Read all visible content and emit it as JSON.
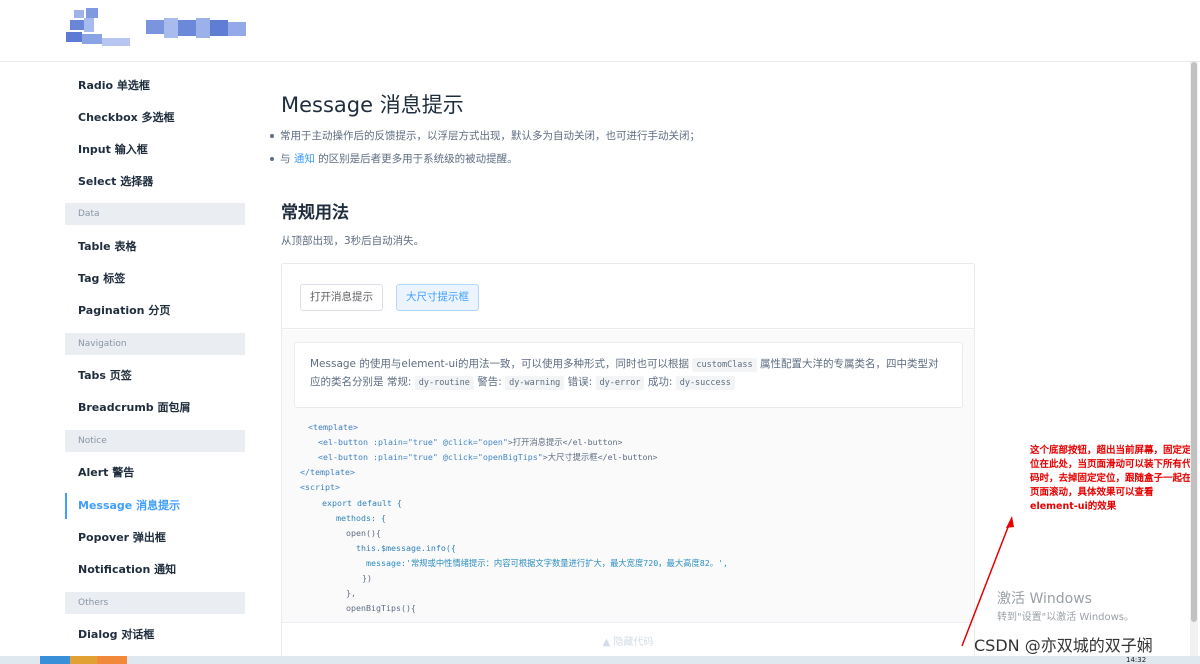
{
  "sidebar": {
    "items": [
      {
        "label": "Radio 单选框"
      },
      {
        "label": "Checkbox 多选框"
      },
      {
        "label": "Input 输入框"
      },
      {
        "label": "Select 选择器"
      },
      {
        "group": "Data"
      },
      {
        "label": "Table 表格"
      },
      {
        "label": "Tag 标签"
      },
      {
        "label": "Pagination 分页"
      },
      {
        "group": "Navigation"
      },
      {
        "label": "Tabs 页签"
      },
      {
        "label": "Breadcrumb 面包屑"
      },
      {
        "group": "Notice"
      },
      {
        "label": "Alert 警告"
      },
      {
        "label": "Message 消息提示",
        "active": true
      },
      {
        "label": "Popover 弹出框"
      },
      {
        "label": "Notification 通知"
      },
      {
        "group": "Others"
      },
      {
        "label": "Dialog 对话框"
      }
    ]
  },
  "page": {
    "title": "Message 消息提示",
    "bullet1": "常用于主动操作后的反馈提示，以浮层方式出现，默认多为自动关闭，也可进行手动关闭；",
    "bullet2_pre": "与 ",
    "bullet2_link": "通知",
    "bullet2_post": " 的区别是后者更多用于系统级的被动提醒。",
    "section_title": "常规用法",
    "section_desc": "从顶部出现，3秒后自动消失。"
  },
  "demo": {
    "btn_open": "打开消息提示",
    "btn_big": "大尺寸提示框",
    "desc_1": "Message 的使用与element-ui的用法一致，可以使用多种形式，同时也可以根据 ",
    "desc_code1": "customClass",
    "desc_2": " 属性配置大洋的专属类名，四中类型对",
    "desc_3": "应的类名分别是 常规: ",
    "desc_code2": "dy-routine",
    "desc_4": " 警告: ",
    "desc_code3": "dy-warning",
    "desc_5": " 错误: ",
    "desc_code4": "dy-error",
    "desc_6": " 成功: ",
    "desc_code5": "dy-success",
    "hide_code": "▲ 隐藏代码",
    "code": {
      "l1": "<template>",
      "l2a": "<el-button ",
      "l2b": ":plain=\"true\" @click=\"open\"",
      "l2c": ">打开消息提示</el-button>",
      "l3a": "<el-button ",
      "l3b": ":plain=\"true\" @click=\"openBigTips\"",
      "l3c": ">大尺寸提示框</el-button>",
      "l4": "</template>",
      "l5": "<script>",
      "l6": "export default {",
      "l7": "methods: {",
      "l8": "open(){",
      "l9": "this.$message.info({",
      "l10": "message:'常规或中性情绪提示：内容可根据文字数量进行扩大，最大宽度720，最大高度82。',",
      "l11": "})",
      "l12": "},",
      "l13": "openBigTips(){"
    }
  },
  "annotation": "这个底部按钮，超出当前屏幕，固定定位在此处，当页面滑动可以装下所有代码时，去掉固定定位，跟随盒子一起在页面滚动，具体效果可以查看element-ui的效果",
  "windows": {
    "activate": "激活 Windows",
    "activate_sub": "转到\"设置\"以激活 Windows。"
  },
  "watermark": "CSDN @亦双城的双子娴",
  "clock": "14:32",
  "colors": {
    "accent": "#409eff",
    "annotation": "#e60000"
  }
}
